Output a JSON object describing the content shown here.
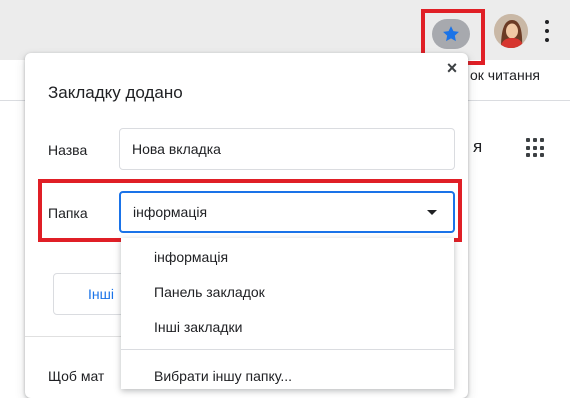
{
  "toolbar": {
    "bookmark_star_icon": "star-icon",
    "avatar_icon": "profile-avatar",
    "menu_icon": "kebab-menu-icon",
    "accent": "#1a73e8",
    "highlight": "#e01f26"
  },
  "background": {
    "bookmarks_bar_text": "ок читання",
    "partial_letter": "я"
  },
  "dialog": {
    "title": "Закладку додано",
    "close_glyph": "×",
    "name_label": "Назва",
    "name_value": "Нова вкладка",
    "folder_label": "Папка",
    "folder_value": "інформація",
    "other_button_label": "Інші",
    "hint_text": "Щоб мат"
  },
  "folder_dropdown": {
    "options": [
      "інформація",
      "Панель закладок",
      "Інші закладки"
    ],
    "choose_other": "Вибрати іншу папку..."
  }
}
